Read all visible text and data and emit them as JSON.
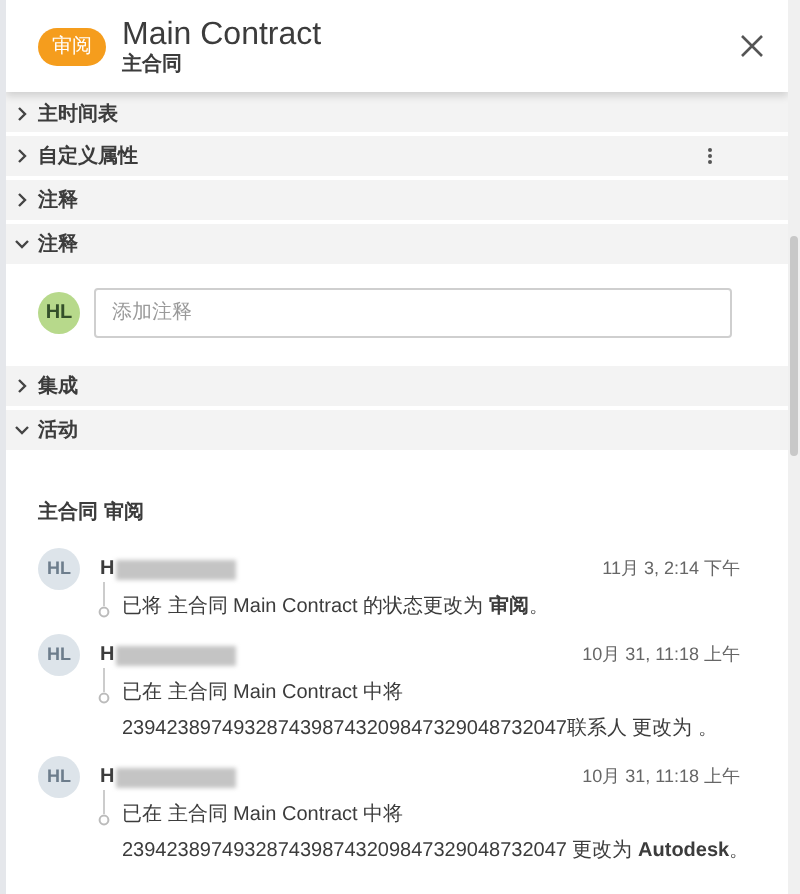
{
  "header": {
    "badge": "审阅",
    "title": "Main Contract",
    "subtitle": "主合同"
  },
  "sections": [
    {
      "label": "主时间表",
      "expanded": false,
      "has_menu": false
    },
    {
      "label": "自定义属性",
      "expanded": false,
      "has_menu": true
    },
    {
      "label": "注释",
      "expanded": false,
      "has_menu": false
    },
    {
      "label": "注释",
      "expanded": true,
      "has_menu": false,
      "composer": {
        "avatar": "HL",
        "placeholder": "添加注释"
      }
    },
    {
      "label": "集成",
      "expanded": false,
      "has_menu": false
    },
    {
      "label": "活动",
      "expanded": true,
      "has_menu": false,
      "activity": {
        "heading": "主合同 审阅",
        "entries": [
          {
            "avatar": "HL",
            "author": "H",
            "redacted": true,
            "time": "11月 3, 2:14 下午",
            "lines": [
              "已将 主合同 Main Contract 的状态更改为 **审阅**。"
            ]
          },
          {
            "avatar": "HL",
            "author": "H",
            "redacted": true,
            "time": "10月 31, 11:18 上午",
            "lines": [
              "已在 主合同 Main Contract 中将",
              "2394238974932874398743209847329048732047联系人 更改为 。"
            ]
          },
          {
            "avatar": "HL",
            "author": "H",
            "redacted": true,
            "time": "10月 31, 11:18 上午",
            "lines": [
              "已在 主合同 Main Contract 中将",
              "2394238974932874398743209847329048732047 更改为 **Autodesk**。"
            ]
          }
        ]
      }
    }
  ]
}
